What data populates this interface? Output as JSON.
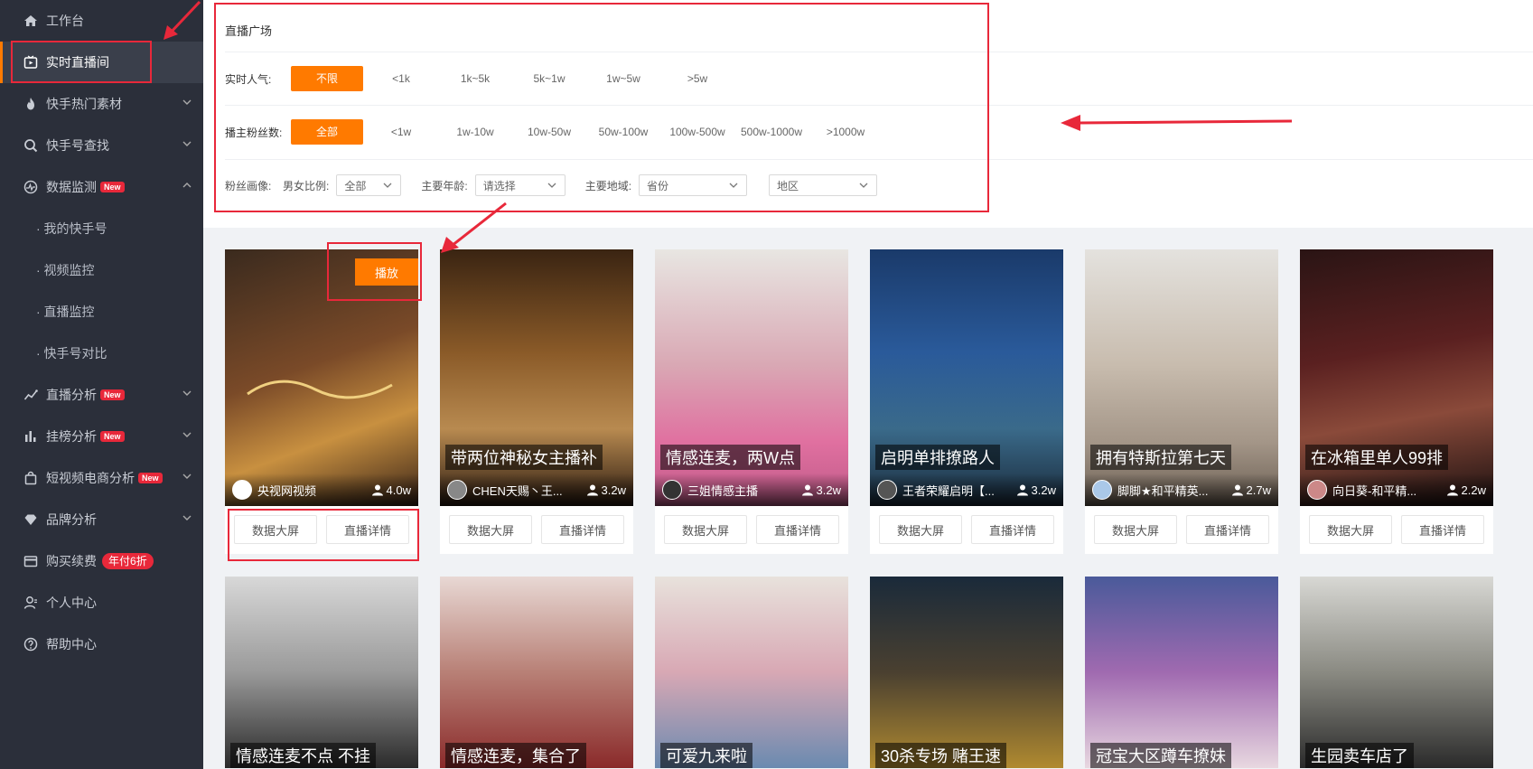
{
  "sidebar": {
    "items": [
      {
        "label": "工作台",
        "icon": "home-icon"
      },
      {
        "label": "实时直播间",
        "icon": "live-icon"
      },
      {
        "label": "快手热门素材",
        "icon": "fire-icon"
      },
      {
        "label": "快手号查找",
        "icon": "search-icon"
      },
      {
        "label": "数据监测",
        "icon": "monitor-icon",
        "badge": "New"
      },
      {
        "label": "直播分析",
        "icon": "trend-icon",
        "badge": "New"
      },
      {
        "label": "挂榜分析",
        "icon": "bar-chart-icon",
        "badge": "New"
      },
      {
        "label": "短视频电商分析",
        "icon": "bag-icon",
        "badge": "New"
      },
      {
        "label": "品牌分析",
        "icon": "diamond-icon"
      },
      {
        "label": "购买续费",
        "icon": "wallet-icon",
        "promo": "年付6折"
      },
      {
        "label": "个人中心",
        "icon": "user-icon"
      },
      {
        "label": "帮助中心",
        "icon": "help-icon"
      }
    ],
    "sub_items": [
      "· 我的快手号",
      "· 视频监控",
      "· 直播监控",
      "· 快手号对比"
    ]
  },
  "filter": {
    "title": "直播广场",
    "popularity_label": "实时人气:",
    "popularity_options": [
      "不限",
      "<1k",
      "1k~5k",
      "5k~1w",
      "1w~5w",
      ">5w"
    ],
    "fans_label": "播主粉丝数:",
    "fans_options": [
      "全部",
      "<1w",
      "1w-10w",
      "10w-50w",
      "50w-100w",
      "100w-500w",
      "500w-1000w",
      ">1000w"
    ],
    "portrait_label": "粉丝画像:",
    "gender_label": "男女比例:",
    "gender_value": "全部",
    "age_label": "主要年龄:",
    "age_value": "请选择",
    "region_label": "主要地域:",
    "province_value": "省份",
    "area_value": "地区"
  },
  "card_buttons": {
    "data_screen": "数据大屏",
    "live_detail": "直播详情",
    "play": "播放"
  },
  "cards": [
    {
      "caption": "",
      "anchor": "央视网视频",
      "viewers": "4.0w",
      "bg": "#5a3a28"
    },
    {
      "caption": "带两位神秘女主播补",
      "anchor": "CHEN天赐丶王...",
      "viewers": "3.2w",
      "bg": "#6e4a24"
    },
    {
      "caption": "情感连麦，两W点",
      "anchor": "三姐情感主播",
      "viewers": "3.2w",
      "bg": "#b97a8a"
    },
    {
      "caption": "启明单排撩路人",
      "anchor": "王者荣耀启明【...",
      "viewers": "3.2w",
      "bg": "#2a4f7a"
    },
    {
      "caption": "拥有特斯拉第七天",
      "anchor": "脚脚★和平精英...",
      "viewers": "2.7w",
      "bg": "#b8b0a6"
    },
    {
      "caption": "在冰箱里单人99排",
      "anchor": "向日葵-和平精...",
      "viewers": "2.2w",
      "bg": "#3a1a1a"
    }
  ],
  "cards_row2": [
    {
      "caption": "情感连麦不点 不挂",
      "bg": "#8c8c8c"
    },
    {
      "caption": "情感连麦，集合了",
      "bg": "#9a6a62"
    },
    {
      "caption": "可爱九来啦",
      "bg": "#c08f98"
    },
    {
      "caption": "30杀专场 赌王速",
      "bg": "#3e3a2e"
    },
    {
      "caption": "冠宝大区蹲车撩妹",
      "bg": "#6a5a9a"
    },
    {
      "caption": "生园卖车店了",
      "bg": "#8a8a82"
    }
  ]
}
